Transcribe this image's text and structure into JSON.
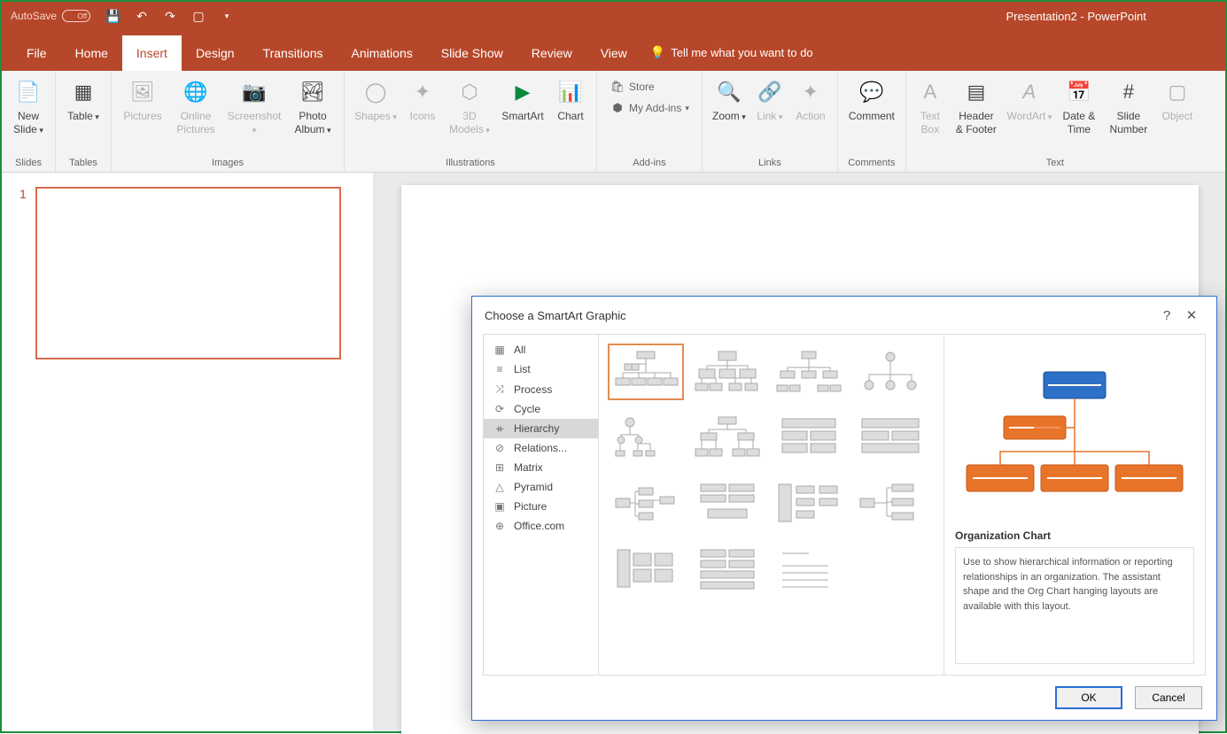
{
  "titlebar": {
    "autosave": "AutoSave",
    "toggle": "Off",
    "title": "Presentation2 - PowerPoint"
  },
  "tabs": [
    "File",
    "Home",
    "Insert",
    "Design",
    "Transitions",
    "Animations",
    "Slide Show",
    "Review",
    "View"
  ],
  "active_tab": "Insert",
  "tell_me": "Tell me what you want to do",
  "ribbon": {
    "slides": {
      "label": "Slides",
      "new_slide": "New\nSlide"
    },
    "tables": {
      "label": "Tables",
      "table": "Table"
    },
    "images": {
      "label": "Images",
      "pictures": "Pictures",
      "online_pictures": "Online\nPictures",
      "screenshot": "Screenshot",
      "photo_album": "Photo\nAlbum"
    },
    "illustrations": {
      "label": "Illustrations",
      "shapes": "Shapes",
      "icons": "Icons",
      "models3d": "3D\nModels",
      "smartart": "SmartArt",
      "chart": "Chart"
    },
    "addins": {
      "label": "Add-ins",
      "store": "Store",
      "my_addins": "My Add-ins"
    },
    "links": {
      "label": "Links",
      "zoom": "Zoom",
      "link": "Link",
      "action": "Action"
    },
    "comments": {
      "label": "Comments",
      "comment": "Comment"
    },
    "text": {
      "label": "Text",
      "text_box": "Text\nBox",
      "header_footer": "Header\n& Footer",
      "wordart": "WordArt",
      "date_time": "Date &\nTime",
      "slide_number": "Slide\nNumber",
      "object": "Object"
    }
  },
  "thumb_number": "1",
  "dialog": {
    "title": "Choose a SmartArt Graphic",
    "categories": [
      "All",
      "List",
      "Process",
      "Cycle",
      "Hierarchy",
      "Relations...",
      "Matrix",
      "Pyramid",
      "Picture",
      "Office.com"
    ],
    "selected_category": "Hierarchy",
    "preview_title": "Organization Chart",
    "preview_desc": "Use to show hierarchical information or reporting relationships in an organization. The assistant shape and the Org Chart hanging layouts are available with this layout.",
    "ok": "OK",
    "cancel": "Cancel"
  },
  "category_icons": [
    "▦",
    "≡",
    "⤨",
    "⟳",
    "ᚑ",
    "⊘",
    "⊞",
    "△",
    "▣",
    "⊕"
  ]
}
